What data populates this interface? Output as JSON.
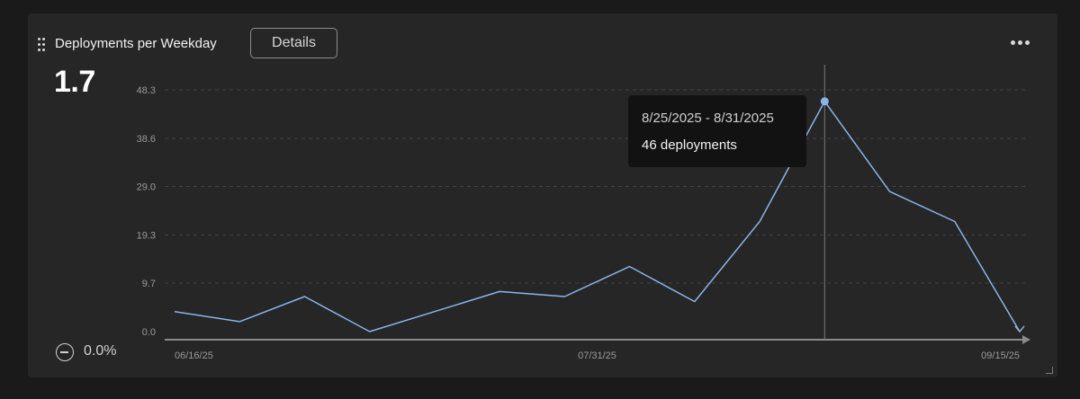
{
  "panel": {
    "title": "Deployments per Weekday",
    "details_label": "Details",
    "stat_value": "1.7",
    "change_value": "0.0%"
  },
  "tooltip": {
    "range": "8/25/2025 - 8/31/2025",
    "value": "46 deployments"
  },
  "colors": {
    "line": "#8ab4e8",
    "background": "#262626",
    "grid": "#444444",
    "text": "#f2f2f2"
  },
  "chart_data": {
    "type": "line",
    "title": "Deployments per Weekday",
    "xlabel": "",
    "ylabel": "",
    "ylim": [
      0.0,
      48.3
    ],
    "yticks": [
      "0.0",
      "9.7",
      "19.3",
      "29.0",
      "38.6",
      "48.3"
    ],
    "x_ticks": [
      "06/16/25",
      "07/31/25",
      "09/15/25"
    ],
    "grid": true,
    "highlight_index": 10,
    "series": [
      {
        "values": [
          4,
          2,
          7,
          0,
          4,
          8,
          7,
          13,
          6,
          22,
          46,
          28,
          22,
          0
        ]
      }
    ]
  }
}
